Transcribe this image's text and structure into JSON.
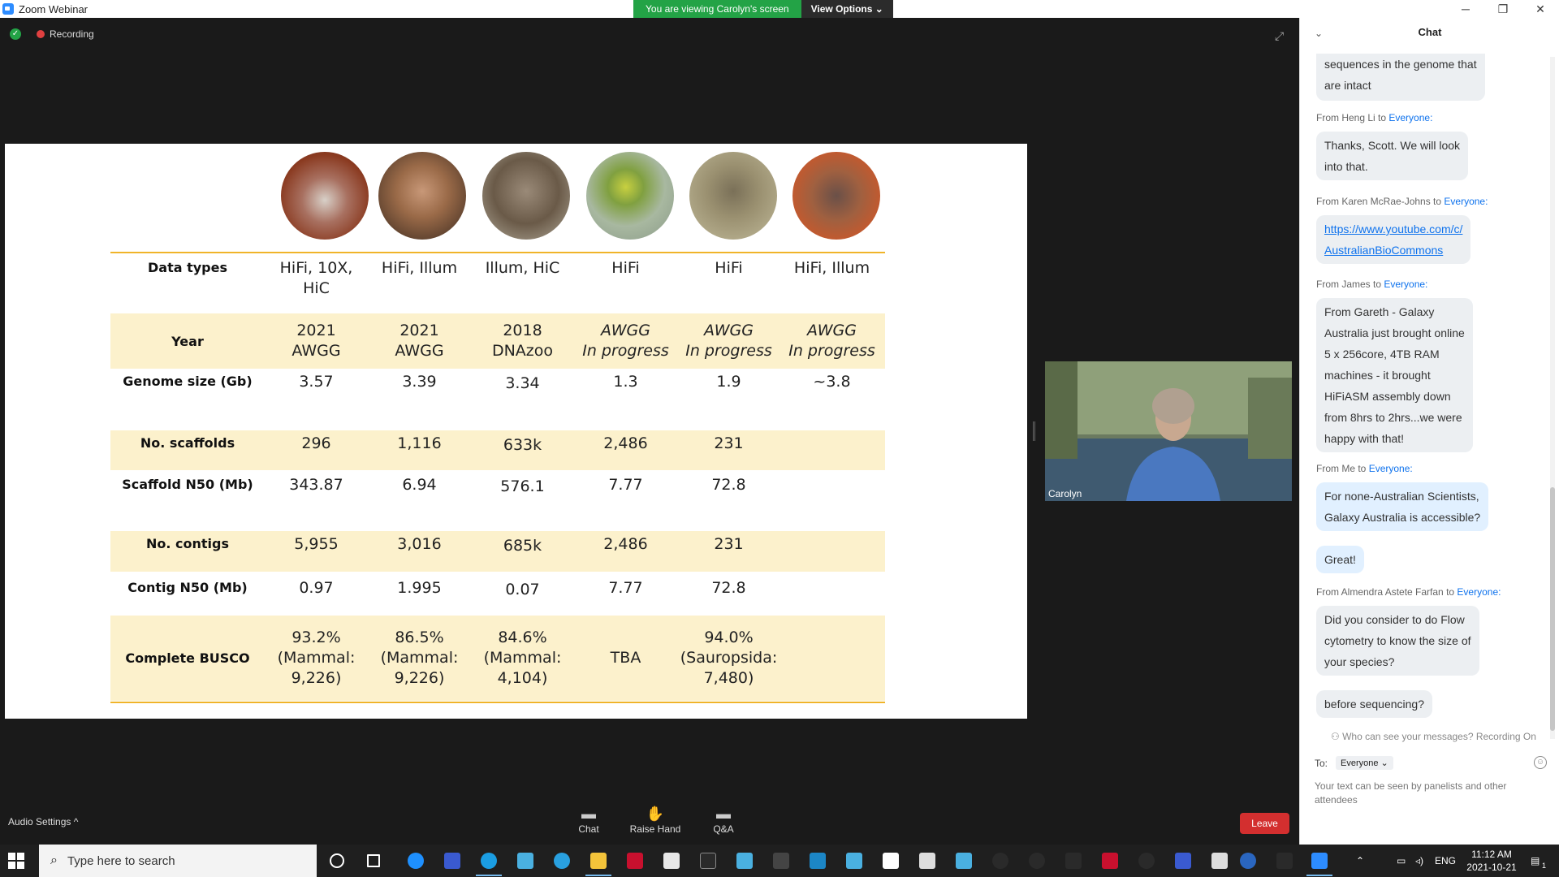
{
  "window": {
    "title": "Zoom Webinar",
    "controls": [
      "─",
      "❐",
      "✕"
    ]
  },
  "banner": {
    "viewing": "You are viewing Carolyn's screen",
    "view_options": "View Options ⌄"
  },
  "status": {
    "recording": "Recording"
  },
  "slide": {
    "rows": [
      {
        "label": "Data types",
        "values": [
          "HiFi, 10X,\nHiC",
          "HiFi, Illum",
          "Illum, HiC",
          "HiFi",
          "HiFi",
          "HiFi, Illum"
        ],
        "highlight": false
      },
      {
        "label": "Year",
        "values": [
          "2021\nAWGG",
          "2021\nAWGG",
          "2018\nDNAzoo",
          "AWGG\nIn progress",
          "AWGG\nIn progress",
          "AWGG\nIn progress"
        ],
        "highlight": true
      },
      {
        "label": "Genome size (Gb)",
        "values": [
          "3.57",
          "3.39",
          "3.34",
          "1.3",
          "1.9",
          "~3.8"
        ],
        "highlight": false
      },
      {
        "label": "No. scaffolds",
        "values": [
          "296",
          "1,116",
          "633k",
          "2,486",
          "231",
          ""
        ],
        "highlight": true
      },
      {
        "label": "Scaffold N50 (Mb)",
        "values": [
          "343.87",
          "6.94",
          "576.1",
          "7.77",
          "72.8",
          ""
        ],
        "highlight": false
      },
      {
        "label": "No. contigs",
        "values": [
          "5,955",
          "3,016",
          "685k",
          "2,486",
          "231",
          ""
        ],
        "highlight": true
      },
      {
        "label": "Contig N50 (Mb)",
        "values": [
          "0.97",
          "1.995",
          "0.07",
          "7.77",
          "72.8",
          ""
        ],
        "highlight": false
      },
      {
        "label": "Complete BUSCO",
        "values": [
          "93.2%\n(Mammal:\n9,226)",
          "86.5%\n(Mammal:\n9,226)",
          "84.6%\n(Mammal:\n4,104)",
          "TBA",
          "94.0%\n(Sauropsida:\n7,480)",
          ""
        ],
        "highlight": true
      }
    ]
  },
  "video": {
    "name": "Carolyn"
  },
  "toolbar": {
    "audio_settings": "Audio Settings ^",
    "chat": "Chat",
    "raise_hand": "Raise Hand",
    "qa": "Q&A",
    "leave": "Leave"
  },
  "chat": {
    "title": "Chat",
    "messages": [
      {
        "from": "",
        "to": "",
        "text": "sequences in the genome that\nare intact"
      },
      {
        "from": "From Heng Li to ",
        "to": "Everyone:",
        "text": "Thanks, Scott. We will look\ninto that."
      },
      {
        "from": "From Karen McRae-Johns to ",
        "to": "Everyone:",
        "text": "https://www.youtube.com/c/\nAustralianBioCommons"
      },
      {
        "from": "From James to ",
        "to": "Everyone:",
        "text": "From Gareth - Galaxy\nAustralia just brought online\n5 x 256core, 4TB RAM\nmachines - it brought\nHiFiASM assembly down\nfrom 8hrs to 2hrs...we were\nhappy with that!"
      },
      {
        "from": "From Me to ",
        "to": "Everyone:",
        "text": "For none-Australian Scientists,\nGalaxy Australia is accessible?"
      },
      {
        "from": "",
        "to": "",
        "text": "Great!"
      },
      {
        "from": "From Almendra Astete Farfan to ",
        "to": "Everyone:",
        "text": "Did you consider to do Flow\ncytometry to know the size of\nyour species?"
      },
      {
        "from": "",
        "to": "",
        "text": "before sequencing?"
      }
    ],
    "who_can_see": "Who can see your messages? Recording On",
    "to_label": "To:",
    "to_value": "Everyone ⌄",
    "placeholder": "Your text can be seen by panelists and other attendees"
  },
  "taskbar": {
    "search": "Type here to search",
    "language": "ENG",
    "time": "11:12 AM",
    "date": "2021-10-21",
    "notification_count": "1"
  },
  "colors": {
    "accent": "#0e72ed",
    "highlight_row": "#fcf1cc",
    "rule": "#f0b429",
    "leave": "#d32f2f",
    "banner": "#23a346"
  }
}
